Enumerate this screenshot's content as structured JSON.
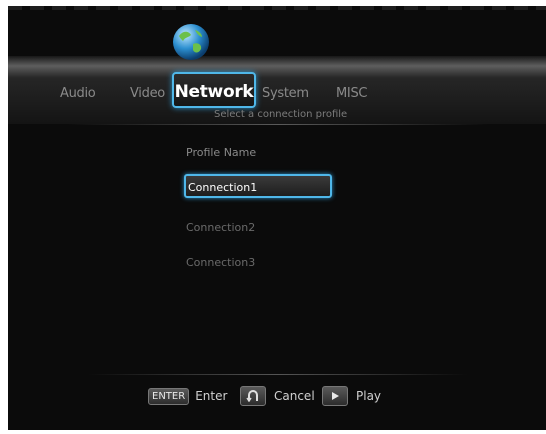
{
  "tabs": {
    "audio": "Audio",
    "video": "Video",
    "network": "Network",
    "system": "System",
    "misc": "MISC"
  },
  "subtitle": "Select a connection profile",
  "profiles": {
    "header": "Profile Name",
    "items": [
      "Connection1",
      "Connection2",
      "Connection3"
    ],
    "selected_index": 0
  },
  "hints": {
    "enter_key": "ENTER",
    "enter_label": "Enter",
    "cancel_icon": "return-arrow-icon",
    "cancel_label": "Cancel",
    "play_icon": "play-triangle-icon",
    "play_label": "Play"
  },
  "colors": {
    "accent": "#4fb7e9",
    "background": "#0b0b0b"
  }
}
